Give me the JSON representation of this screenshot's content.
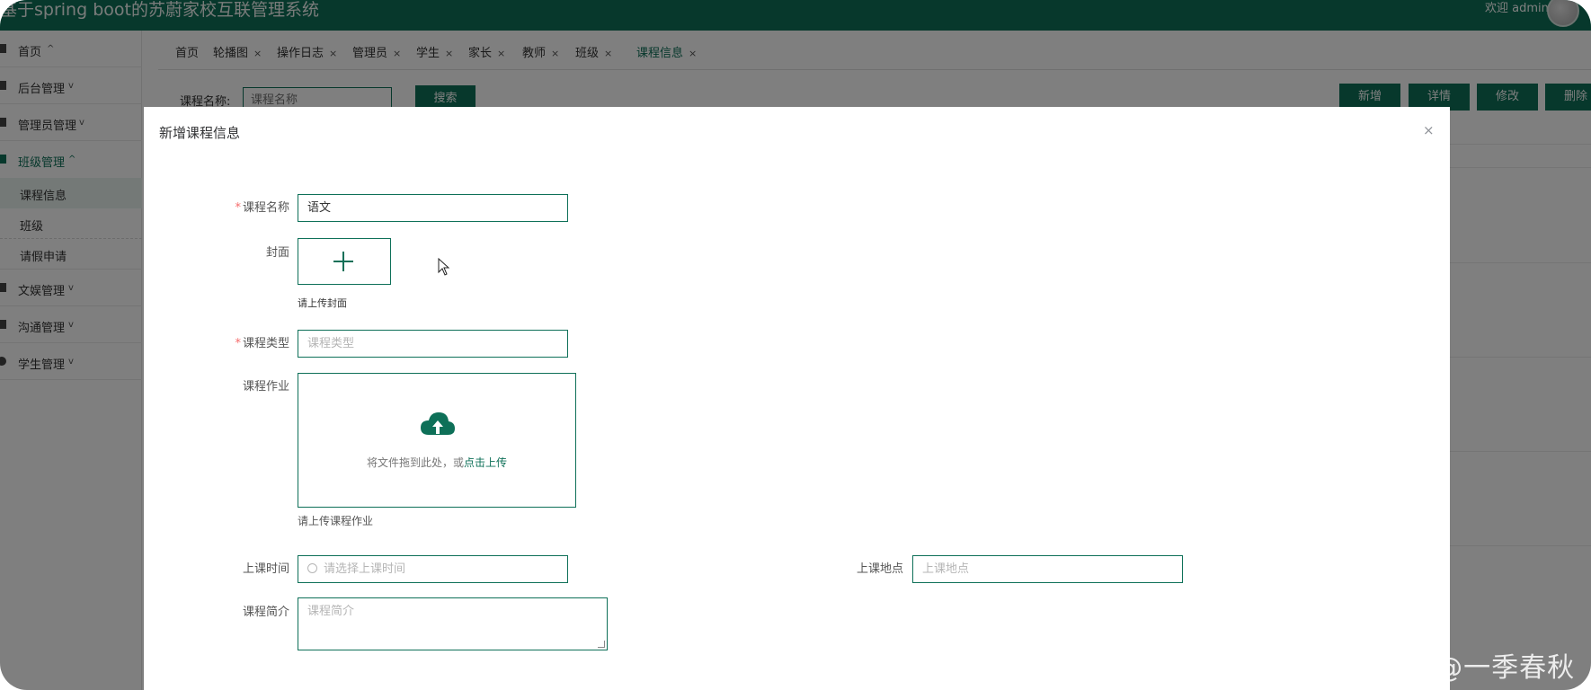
{
  "header": {
    "title": "基于spring boot的苏蔚家校互联管理系统",
    "welcome": "欢迎 admin"
  },
  "sidebar": {
    "items": [
      {
        "label": "首页",
        "chevron": "^"
      },
      {
        "label": "后台管理",
        "chevron": "v"
      },
      {
        "label": "管理员管理",
        "chevron": "v"
      },
      {
        "label": "班级管理",
        "chevron": "^"
      },
      {
        "label": "文娱管理",
        "chevron": "v"
      },
      {
        "label": "沟通管理",
        "chevron": "v"
      },
      {
        "label": "学生管理",
        "chevron": "v"
      }
    ],
    "subitems": [
      {
        "label": "课程信息"
      },
      {
        "label": "班级"
      },
      {
        "label": "请假申请"
      }
    ]
  },
  "tabs": [
    {
      "label": "首页"
    },
    {
      "label": "轮播图",
      "close": "×"
    },
    {
      "label": "操作日志",
      "close": "×"
    },
    {
      "label": "管理员",
      "close": "×"
    },
    {
      "label": "学生",
      "close": "×"
    },
    {
      "label": "家长",
      "close": "×"
    },
    {
      "label": "教师",
      "close": "×"
    },
    {
      "label": "班级",
      "close": "×"
    },
    {
      "label": "课程信息",
      "close": "×"
    }
  ],
  "toolbar": {
    "search_label": "课程名称:",
    "search_placeholder": "课程名称",
    "search_button": "搜索",
    "new_button": "新增",
    "detail_button": "详情",
    "edit_button": "修改",
    "delete_button": "删除"
  },
  "dialog": {
    "title": "新增课程信息",
    "close": "×",
    "fields": {
      "course_name": {
        "label": "课程名称",
        "value": "语文",
        "required": true
      },
      "cover": {
        "label": "封面",
        "hint": "请上传封面"
      },
      "course_type": {
        "label": "课程类型",
        "placeholder": "课程类型",
        "required": true
      },
      "homework": {
        "label": "课程作业",
        "drop_text": "将文件拖到此处，或",
        "drop_link": "点击上传",
        "hint": "请上传课程作业"
      },
      "class_time": {
        "label": "上课时间",
        "placeholder": "请选择上课时间"
      },
      "location": {
        "label": "上课地点",
        "placeholder": "上课地点"
      },
      "intro": {
        "label": "课程简介",
        "placeholder": "课程简介"
      }
    }
  },
  "watermark": "CSDN @一季春秋",
  "colors": {
    "accent": "#0e7058",
    "required": "#f56c6c"
  }
}
